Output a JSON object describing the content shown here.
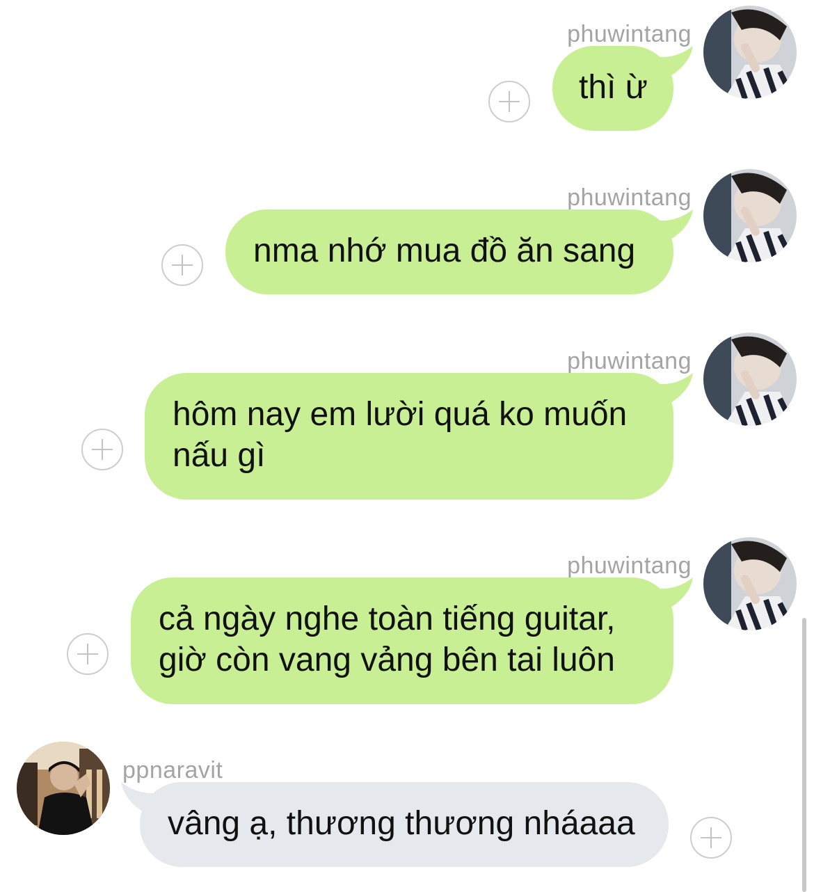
{
  "messages": [
    {
      "user": "phuwintang",
      "text_lines": [
        "thì ừ"
      ],
      "direction": "outgoing"
    },
    {
      "user": "phuwintang",
      "text_lines": [
        "nma nhớ mua đồ ăn sang"
      ],
      "direction": "outgoing"
    },
    {
      "user": "phuwintang",
      "text_lines": [
        "hôm nay em lười quá ko muốn",
        "nấu gì"
      ],
      "direction": "outgoing"
    },
    {
      "user": "phuwintang",
      "text_lines": [
        "cả ngày nghe toàn tiếng guitar,",
        "giờ còn vang vảng bên tai luôn"
      ],
      "direction": "outgoing"
    },
    {
      "user": "ppnaravit",
      "text_lines": [
        "vâng ạ, thương thương nháaaa"
      ],
      "direction": "incoming"
    }
  ],
  "colors": {
    "outgoing_bubble": "#c9ef95",
    "incoming_bubble": "#e5e8ec",
    "username": "#a4a4a4",
    "background": "#ffffff"
  },
  "icons": {
    "add": "plus-circle-icon",
    "avatar_outgoing": "avatar-phuwintang",
    "avatar_incoming": "avatar-ppnaravit"
  }
}
